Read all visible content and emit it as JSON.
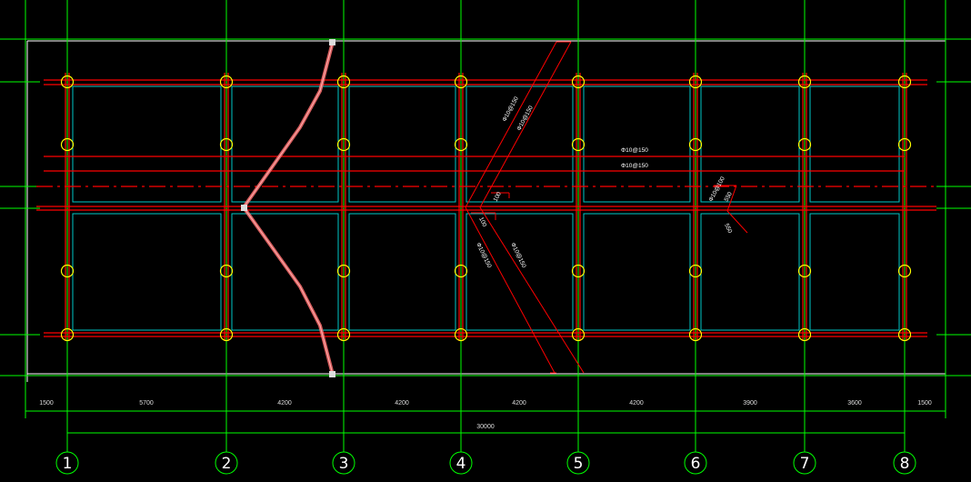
{
  "drawing": {
    "axis_labels": [
      "1",
      "2",
      "3",
      "4",
      "5",
      "6",
      "7",
      "8"
    ],
    "bay_dimensions": [
      "1500",
      "5700",
      "4200",
      "4200",
      "4200",
      "4200",
      "3900",
      "3600",
      "1500"
    ],
    "total_dimension": "30000",
    "rebar_labels": {
      "diag_upper_1": "Φ10@150",
      "diag_upper_2": "Φ10@150",
      "horiz_1": "Φ10@150",
      "horiz_2": "Φ10@150",
      "diag_lower_1": "Φ10@150",
      "diag_lower_2": "Φ10@150",
      "small_right": "Φ10@100",
      "offset_a": "100",
      "offset_b": "100",
      "offset_c": "550",
      "offset_d": "550"
    },
    "colors": {
      "grid": "#00ff00",
      "beam": "#ff0000",
      "slab_edge": "#00c8c8",
      "column": "#ffff00",
      "boundary": "#ffffff",
      "break_line": "#ff7070"
    }
  }
}
